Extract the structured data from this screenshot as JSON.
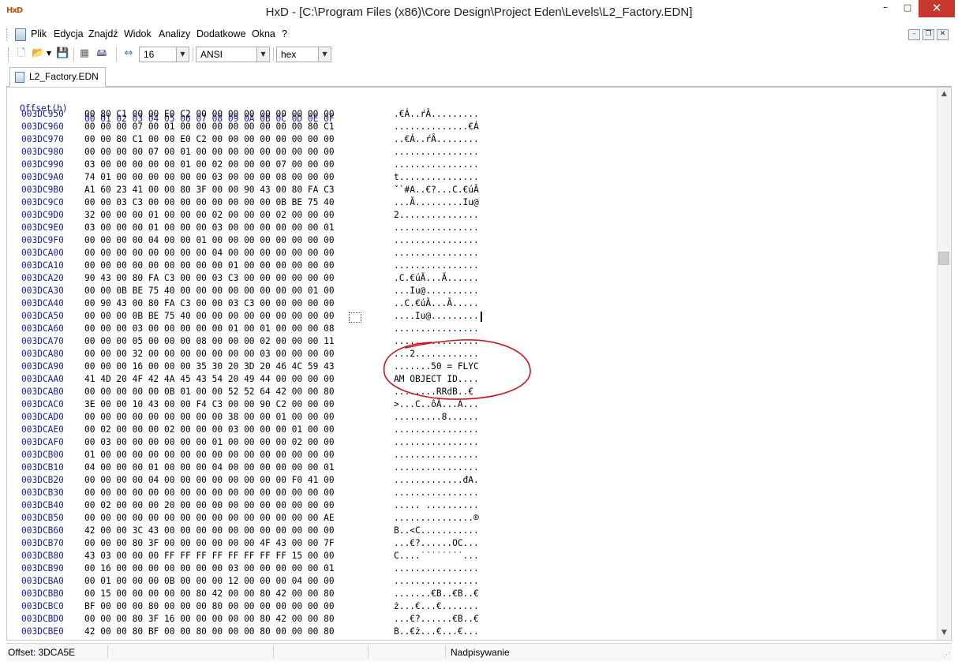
{
  "window": {
    "title": "HxD - [C:\\Program Files (x86)\\Core Design\\Project Eden\\Levels\\L2_Factory.EDN]",
    "app_icon": "HxD"
  },
  "menu": [
    "Plik",
    "Edycja",
    "Znajdź",
    "Widok",
    "Analizy",
    "Dodatkowe",
    "Okna",
    "?"
  ],
  "toolbar": {
    "bytes_per_row": "16",
    "charset": "ANSI",
    "offset_base": "hex"
  },
  "tab": {
    "label": "L2_Factory.EDN"
  },
  "editor": {
    "header_offset": "Offset(h)",
    "header_cols": "00 01 02 03 04 05 06 07 08 09 0A 0B 0C 0D 0E 0F",
    "rows": [
      {
        "off": "003DC950",
        "hex": "00 80 C1 00 00 E0 C2 00 00 00 00 00 00 00 00 00",
        "txt": ".€Á..ŕÂ........."
      },
      {
        "off": "003DC960",
        "hex": "00 00 00 07 00 01 00 00 00 00 00 00 00 00 80 C1",
        "txt": "..............€Á"
      },
      {
        "off": "003DC970",
        "hex": "00 00 80 C1 00 00 E0 C2 00 00 00 00 00 00 00 00",
        "txt": "..€Á..ŕÂ........"
      },
      {
        "off": "003DC980",
        "hex": "00 00 00 00 07 00 01 00 00 00 00 00 00 00 00 00",
        "txt": "................"
      },
      {
        "off": "003DC990",
        "hex": "03 00 00 00 00 00 01 00 02 00 00 00 07 00 00 00",
        "txt": "................"
      },
      {
        "off": "003DC9A0",
        "hex": "74 01 00 00 00 00 00 00 03 00 00 00 08 00 00 00",
        "txt": "t..............."
      },
      {
        "off": "003DC9B0",
        "hex": "A1 60 23 41 00 00 80 3F 00 00 90 43 00 80 FA C3",
        "txt": "ˇ`#A..€?...C.€úĂ"
      },
      {
        "off": "003DC9C0",
        "hex": "00 00 03 C3 00 00 00 00 00 00 00 00 0B BE 75 40",
        "txt": "...Ă.........Iu@"
      },
      {
        "off": "003DC9D0",
        "hex": "32 00 00 00 01 00 00 00 02 00 00 00 02 00 00 00",
        "txt": "2..............."
      },
      {
        "off": "003DC9E0",
        "hex": "03 00 00 00 01 00 00 00 03 00 00 00 00 00 00 01",
        "txt": "................"
      },
      {
        "off": "003DC9F0",
        "hex": "00 00 00 00 04 00 00 01 00 00 00 00 00 00 00 00",
        "txt": "................"
      },
      {
        "off": "003DCA00",
        "hex": "00 00 00 00 00 00 00 00 04 00 00 00 00 00 00 00",
        "txt": "................"
      },
      {
        "off": "003DCA10",
        "hex": "00 00 00 00 00 00 00 00 00 01 00 00 00 00 00 00",
        "txt": "................"
      },
      {
        "off": "003DCA20",
        "hex": "90 43 00 80 FA C3 00 00 03 C3 00 00 00 00 00 00",
        "txt": ".C.€úĂ...Ă......"
      },
      {
        "off": "003DCA30",
        "hex": "00 00 0B BE 75 40 00 00 00 00 00 00 00 00 01 00",
        "txt": "...Iu@.........."
      },
      {
        "off": "003DCA40",
        "hex": "00 90 43 00 80 FA C3 00 00 03 C3 00 00 00 00 00",
        "txt": "..C.€úĂ...Ă....."
      },
      {
        "off": "003DCA50",
        "hex": "00 00 00 0B BE 75 40 00 00 00 00 00 00 00 00 00",
        "txt": "....Iu@........."
      },
      {
        "off": "003DCA60",
        "hex": "00 00 00 03 00 00 00 00 00 01 00 01 00 00 00 08",
        "txt": "................"
      },
      {
        "off": "003DCA70",
        "hex": "00 00 00 05 00 00 00 08 00 00 00 02 00 00 00 11",
        "txt": "................"
      },
      {
        "off": "003DCA80",
        "hex": "00 00 00 32 00 00 00 00 00 00 00 03 00 00 00 00",
        "txt": "...2............"
      },
      {
        "off": "003DCA90",
        "hex": "00 00 00 16 00 00 00 35 30 20 3D 20 46 4C 59 43",
        "txt": ".......50 = FLYC"
      },
      {
        "off": "003DCAA0",
        "hex": "41 4D 20 4F 42 4A 45 43 54 20 49 44 00 00 00 00",
        "txt": "AM OBJECT ID...."
      },
      {
        "off": "003DCAB0",
        "hex": "00 00 00 00 00 0B 01 00 00 52 52 64 42 00 00 80",
        "txt": "........RRdB..€"
      },
      {
        "off": "003DCAC0",
        "hex": "3E 00 00 10 43 00 00 F4 C3 00 00 90 C2 00 00 00",
        "txt": ">...C..ôĂ...Â..."
      },
      {
        "off": "003DCAD0",
        "hex": "00 00 00 00 00 00 00 00 00 38 00 00 01 00 00 00",
        "txt": ".........8......"
      },
      {
        "off": "003DCAE0",
        "hex": "00 02 00 00 00 02 00 00 00 03 00 00 00 01 00 00",
        "txt": "................"
      },
      {
        "off": "003DCAF0",
        "hex": "00 03 00 00 00 00 00 00 01 00 00 00 00 02 00 00",
        "txt": "................"
      },
      {
        "off": "003DCB00",
        "hex": "01 00 00 00 00 00 00 00 00 00 00 00 00 00 00 00",
        "txt": "................"
      },
      {
        "off": "003DCB10",
        "hex": "04 00 00 00 01 00 00 00 04 00 00 00 00 00 00 01",
        "txt": "................"
      },
      {
        "off": "003DCB20",
        "hex": "00 00 00 00 04 00 00 00 00 00 00 00 00 F0 41 00",
        "txt": ".............đA."
      },
      {
        "off": "003DCB30",
        "hex": "00 00 00 00 00 00 00 00 00 00 00 00 00 00 00 00",
        "txt": "................"
      },
      {
        "off": "003DCB40",
        "hex": "00 02 00 00 00 20 00 00 00 00 00 00 00 00 00 00",
        "txt": "..... .........."
      },
      {
        "off": "003DCB50",
        "hex": "00 00 00 00 00 00 00 00 00 00 00 00 00 00 00 AE",
        "txt": "...............®"
      },
      {
        "off": "003DCB60",
        "hex": "42 00 00 3C 43 00 00 00 00 00 00 00 00 00 00 00",
        "txt": "B..<C..........."
      },
      {
        "off": "003DCB70",
        "hex": "00 00 00 80 3F 00 00 00 00 00 00 4F 43 00 00 7F",
        "txt": "...€?......OC..."
      },
      {
        "off": "003DCB80",
        "hex": "43 03 00 00 00 FF FF FF FF FF FF FF FF 15 00 00",
        "txt": "C....˙˙˙˙˙˙˙˙..."
      },
      {
        "off": "003DCB90",
        "hex": "00 16 00 00 00 00 00 00 00 03 00 00 00 00 00 01",
        "txt": "................"
      },
      {
        "off": "003DCBA0",
        "hex": "00 01 00 00 00 0B 00 00 00 12 00 00 00 04 00 00",
        "txt": "................"
      },
      {
        "off": "003DCBB0",
        "hex": "00 15 00 00 00 00 00 80 42 00 00 80 42 00 00 80",
        "txt": ".......€B..€B..€"
      },
      {
        "off": "003DCBC0",
        "hex": "BF 00 00 00 80 00 00 00 80 00 00 00 00 00 00 00",
        "txt": "ż...€...€......."
      },
      {
        "off": "003DCBD0",
        "hex": "00 00 00 80 3F 16 00 00 00 00 00 80 42 00 00 80",
        "txt": "...€?......€B..€"
      },
      {
        "off": "003DCBE0",
        "hex": "42 00 00 80 BF 00 00 80 00 00 00 80 00 00 00 80",
        "txt": "B..€ż...€...€..."
      }
    ]
  },
  "status": {
    "offset": "Offset: 3DCA5E",
    "mode": "Nadpisywanie"
  },
  "colors": {
    "offset_blue": "#1a1aa8",
    "close_red": "#c7372c",
    "annotation_red": "#d0141e"
  }
}
